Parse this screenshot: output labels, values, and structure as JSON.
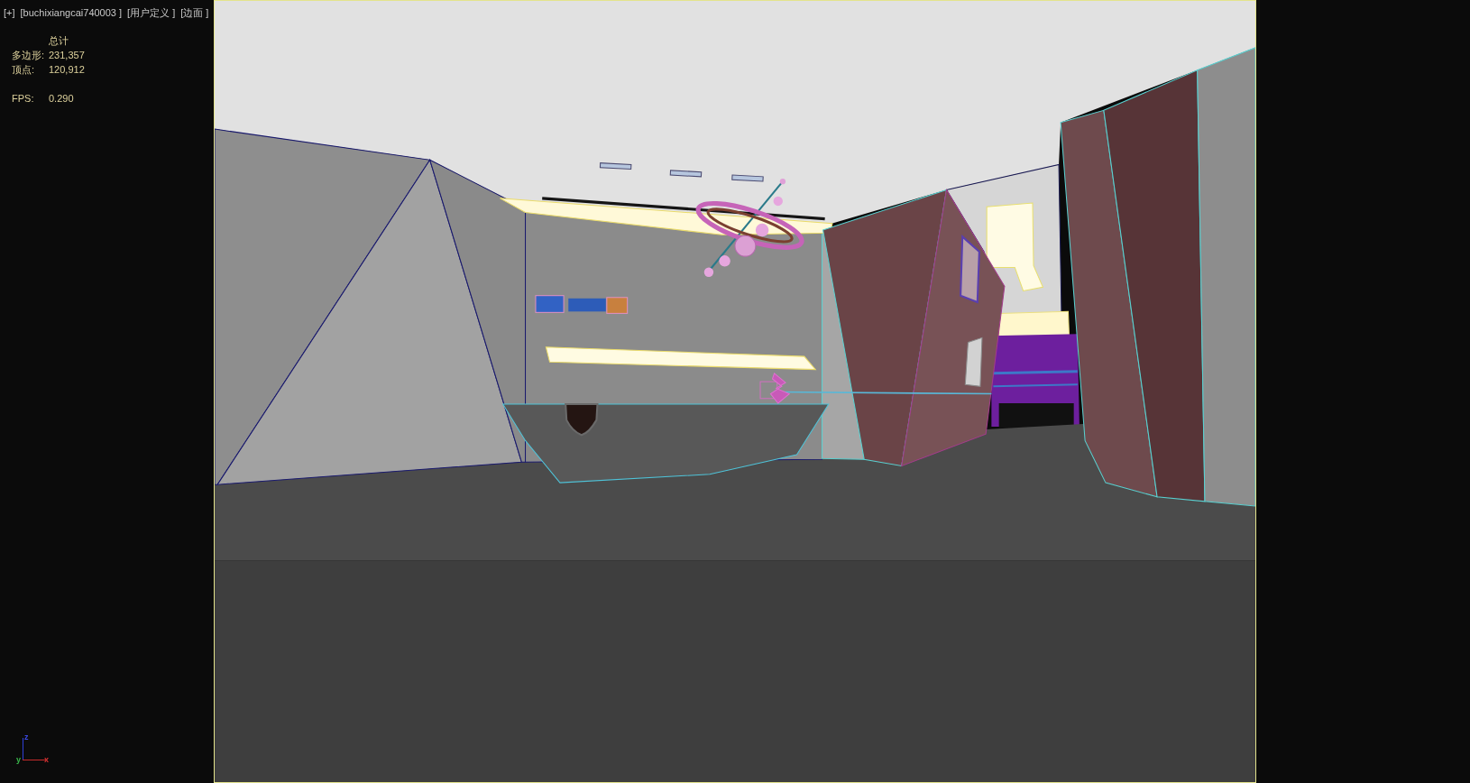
{
  "viewport_label": [
    "[+]",
    "[buchixiangcai740003 ]",
    "[用户定义 ]",
    "[边面 ]"
  ],
  "statistics": {
    "header": "总计",
    "rows": [
      {
        "label": "多边形:",
        "value": "231,357"
      },
      {
        "label": "顶点:",
        "value": "120,912"
      }
    ]
  },
  "fps": {
    "label": "FPS:",
    "value": "0.290"
  },
  "axis_gizmo": [
    {
      "kind": "z",
      "label": "z"
    },
    {
      "kind": "x",
      "label": "x"
    },
    {
      "kind": "y",
      "label": "y"
    }
  ]
}
